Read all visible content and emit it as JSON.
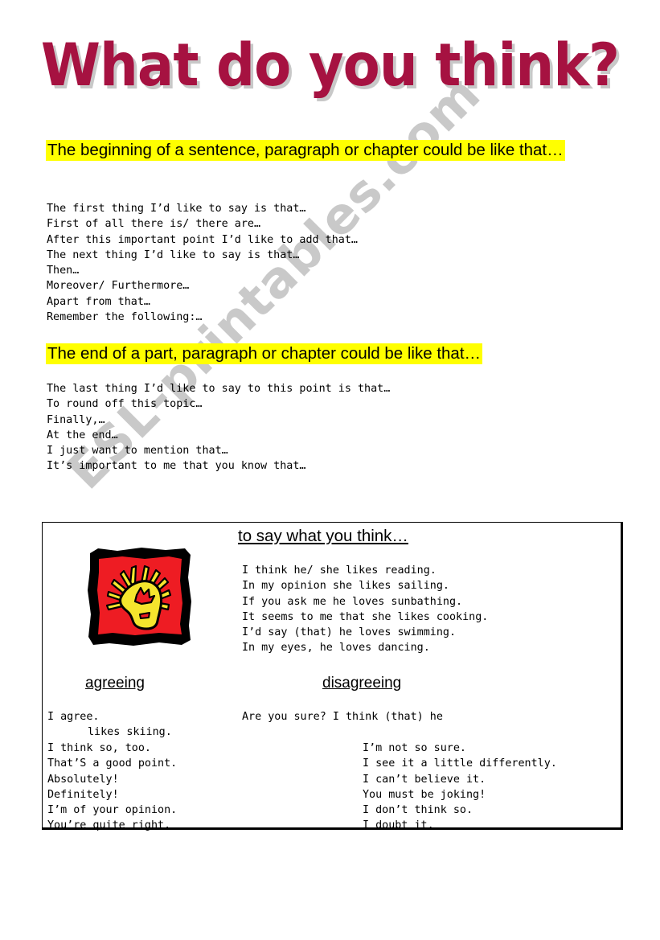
{
  "page": {
    "title": "What do you think?",
    "watermark": "ESL-printables.com",
    "accent_color": "#a61241",
    "highlight_color": "#ffff00"
  },
  "section_beginning": {
    "heading": "The beginning of a sentence, paragraph or chapter could be like that…",
    "phrases": [
      "The first thing I’d like to say is that…",
      "First of all there is/ there are…",
      "After this important point I’d like to add that…",
      "The next thing I’d like to say is that…",
      "Then…",
      "Moreover/ Furthermore…",
      "Apart from that…",
      "Remember the following:…"
    ]
  },
  "section_end": {
    "heading": "The end of a part, paragraph or chapter could be like that…",
    "phrases": [
      "The last thing I’d like to say to this point is that…",
      "To round off this topic…",
      "Finally,…",
      "At the end…",
      "I just want to mention that…",
      "It’s important to me that you know that…"
    ]
  },
  "opinion_box": {
    "heading": "to say what you think…",
    "clipart_name": "thinking-head-clipart",
    "clipart_colors": {
      "background": "#ee1c23",
      "figure": "#f5e52d",
      "outline": "#000000"
    },
    "phrases": [
      "I think he/ she likes reading.",
      "In my opinion she likes sailing.",
      "If you ask me he loves sunbathing.",
      "It seems to me that she likes cooking.",
      "I’d say (that) he loves swimming.",
      "In my eyes, he loves dancing."
    ],
    "agreeing": {
      "heading": "agreeing",
      "first": "I agree.",
      "phrases": [
        "I think so, too.",
        "That’S a good point.",
        "Absolutely!",
        "Definitely!",
        "I’m of your opinion.",
        "You’re quite right."
      ]
    },
    "disagreeing": {
      "heading": "disagreeing",
      "first_line1": "Are you sure? I think (that) he",
      "first_line2": "likes skiing.",
      "phrases": [
        "I’m not so sure.",
        "I see it a little differently.",
        "I can’t believe it.",
        "You must be joking!",
        "I don’t think so.",
        "I doubt it."
      ]
    }
  }
}
